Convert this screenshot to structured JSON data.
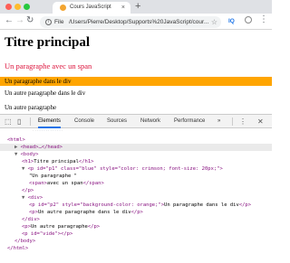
{
  "browser": {
    "tab_title": "Cours JavaScript",
    "tab_close": "×",
    "new_tab": "+",
    "address_label": "File",
    "address_url": "/Users/Pierre/Desktop/Supports%20JavaScript/cour...",
    "ext_label": "IQ",
    "traffic_lights": [
      "#fe5f57",
      "#febc2e",
      "#28c840"
    ],
    "icons": {
      "info": "info-icon",
      "back": "back-arrow-icon",
      "forward": "forward-arrow-icon",
      "reload": "reload-icon",
      "bookmark": "star-icon"
    }
  },
  "page": {
    "h1": "Titre principal",
    "p1": "Un paragraphe avec un span",
    "div_p2": "Un paragraphe dans le div",
    "div_p": "Un autre paragraphe dans le div",
    "outer_p": "Un autre paragraphe"
  },
  "devtools": {
    "tabs": [
      "Elements",
      "Console",
      "Sources",
      "Network",
      "Performance"
    ],
    "more": "»",
    "active_tab": "Elements",
    "accent": "#1a73e8",
    "tree": [
      {
        "indent": 0,
        "arrow": "",
        "tag": "<html>"
      },
      {
        "indent": 1,
        "arrow": "▶",
        "tag": "<head>…</head>"
      },
      {
        "indent": 1,
        "arrow": "▼",
        "tag": "<body>"
      },
      {
        "indent": 2,
        "arrow": "",
        "tag": "<h1>",
        "text": "Titre principal",
        "close": "</h1>"
      },
      {
        "indent": 2,
        "arrow": "▼",
        "tag": "<p id=\"p1\" class=\"blue\" style=\"color: crimson; font-size: 20px;\">"
      },
      {
        "indent": 3,
        "arrow": "",
        "text": "\"Un paragraphe \""
      },
      {
        "indent": 3,
        "arrow": "",
        "tag": "<span>",
        "text": "avec un span",
        "close": "</span>"
      },
      {
        "indent": 2,
        "arrow": "",
        "tag": "</p>"
      },
      {
        "indent": 2,
        "arrow": "▼",
        "tag": "<div>"
      },
      {
        "indent": 3,
        "arrow": "",
        "tag": "<p id=\"p2\" style=\"background-color: orange;\">",
        "text": "Un paragraphe dans le div",
        "close": "</p>"
      },
      {
        "indent": 3,
        "arrow": "",
        "tag": "<p>",
        "text": "Un autre paragraphe dans le div",
        "close": "</p>"
      },
      {
        "indent": 2,
        "arrow": "",
        "tag": "</div>"
      },
      {
        "indent": 2,
        "arrow": "",
        "tag": "<p>",
        "text": "Un autre paragraphe",
        "close": "</p>"
      },
      {
        "indent": 2,
        "arrow": "",
        "tag": "<p id=\"vide\">",
        "close": "</p>"
      },
      {
        "indent": 1,
        "arrow": "",
        "tag": "</body>"
      },
      {
        "indent": 0,
        "arrow": "",
        "tag": "</html>"
      }
    ]
  }
}
